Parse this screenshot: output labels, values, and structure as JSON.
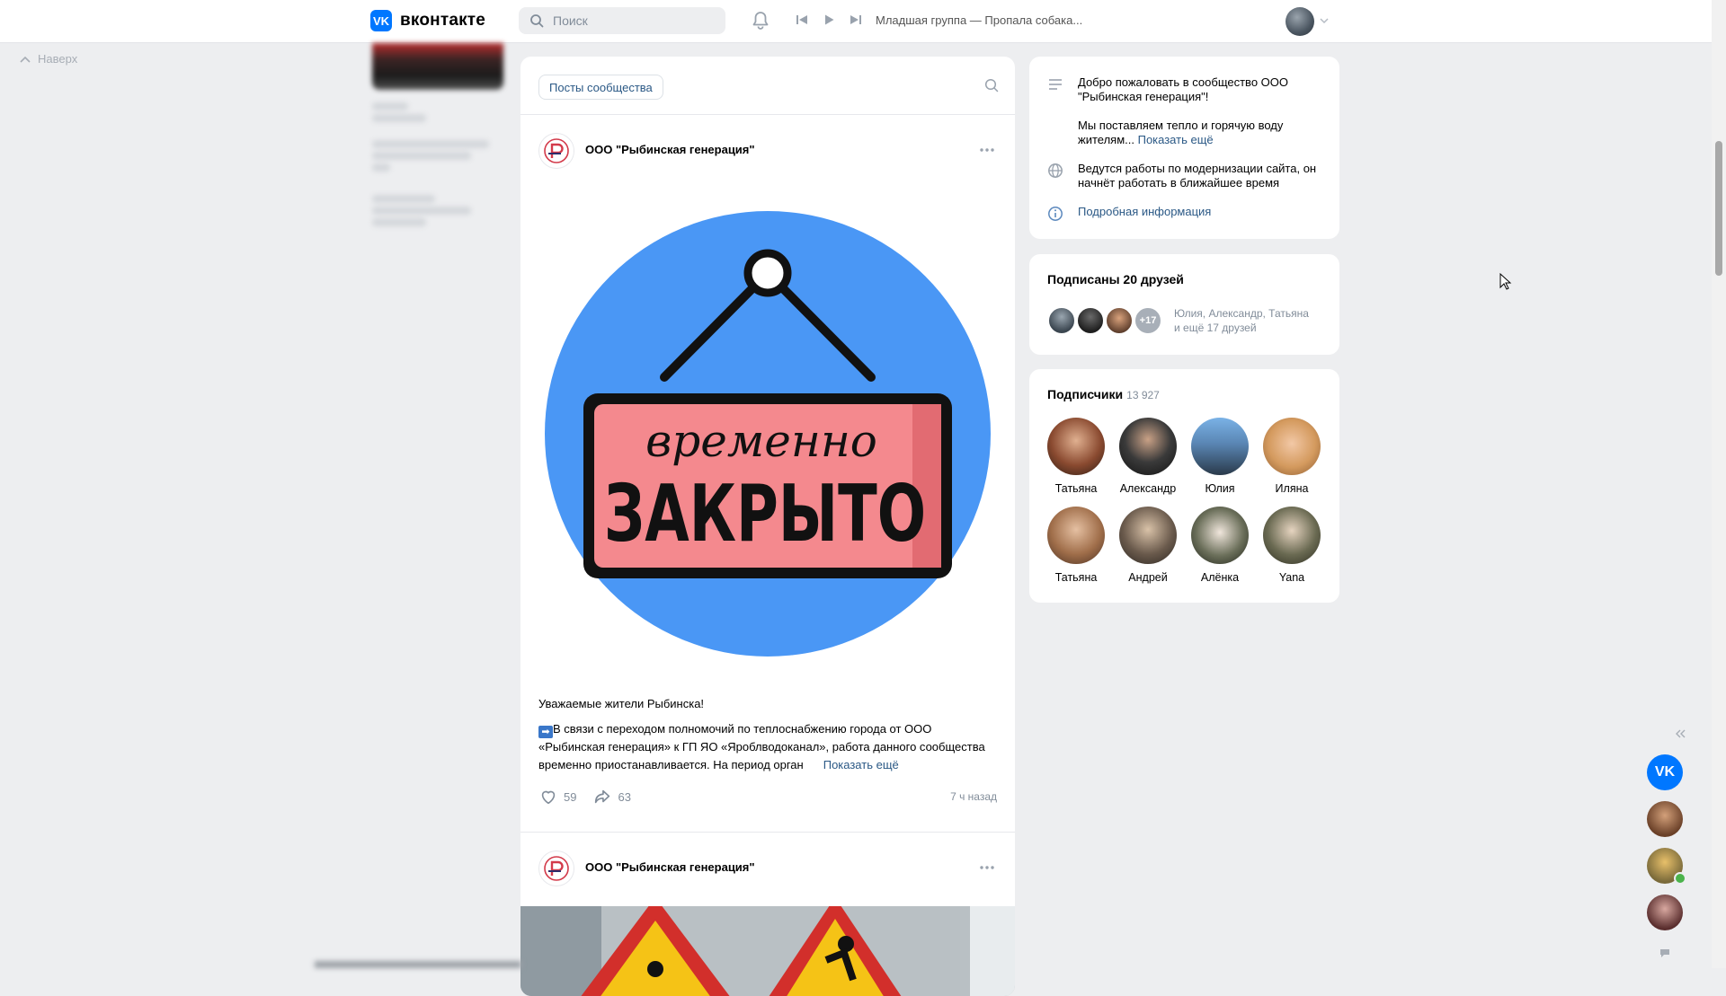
{
  "header": {
    "logo_mark": "VK",
    "logo_text": "вконтакте",
    "search_placeholder": "Поиск",
    "now_playing": "Младшая группа — Пропала собака..."
  },
  "left": {
    "back_to_top": "Наверх"
  },
  "feed": {
    "tab_label": "Посты сообщества",
    "post1": {
      "author": "ООО \"Рыбинская генерация\"",
      "image_text_top": "временно",
      "image_text_main": "ЗАКРЫТО",
      "title": "Уважаемые жители Рыбинска!",
      "text": "В связи с переходом полномочий по теплоснабжению города от ООО «Рыбинская генерация» к ГП ЯО «Яроблводоканал», работа данного сообщества временно приостанавливается. На период орган",
      "show_more": "Показать ещё",
      "likes": "59",
      "shares": "63",
      "time": "7 ч назад"
    },
    "post2": {
      "author": "ООО \"Рыбинская генерация\""
    }
  },
  "info": {
    "welcome": "Добро пожаловать в сообщество ООО \"Рыбинская генерация\"!",
    "about": "Мы поставляем тепло и горячую воду жителям...",
    "about_more": "Показать ещё",
    "notice": "Ведутся работы по модернизации сайта, он начнёт работать в ближайшее время",
    "details_link": "Подробная информация"
  },
  "friends": {
    "title": "Подписаны 20 друзей",
    "extra_badge": "+17",
    "names_line1": "Юлия, Александр, Татьяна",
    "names_line2": "и ещё 17 друзей"
  },
  "subscribers": {
    "title": "Подписчики",
    "count": "13 927",
    "people": [
      "Татьяна",
      "Александр",
      "Юлия",
      "Иляна",
      "Татьяна",
      "Андрей",
      "Алёнка",
      "Yana"
    ]
  },
  "colors": {
    "accent": "#0077ff",
    "link": "#2a5885",
    "secondary_text": "#818c99",
    "page_bg": "#edeef0",
    "sign_bg": "#4a97f5",
    "sign_plate": "#f4898e"
  }
}
